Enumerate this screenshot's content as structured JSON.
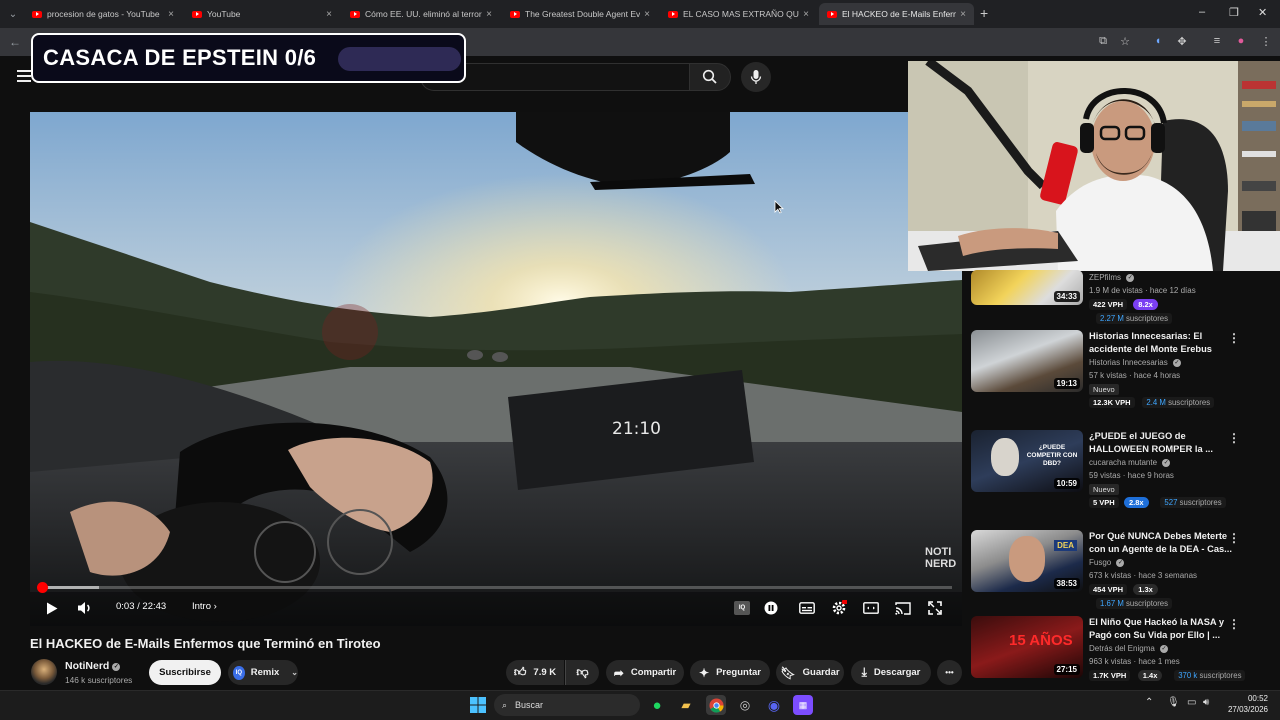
{
  "browser": {
    "tabs": [
      {
        "title": "procesion de gatos - YouTube",
        "active": false
      },
      {
        "title": "YouTube",
        "active": false
      },
      {
        "title": "Cómo EE. UU. eliminó al terrorista",
        "active": false
      },
      {
        "title": "The Greatest Double Agent Ever",
        "active": false
      },
      {
        "title": "EL CASO MAS EXTRAÑO QUE HE",
        "active": false
      },
      {
        "title": "El HACKEO de E-Mails Enfermos",
        "active": true
      }
    ],
    "new_tab_label": "+",
    "close_glyph": "×",
    "window_controls": [
      "–",
      "❐",
      "✕"
    ]
  },
  "stream_overlay": {
    "title": "CASACA DE EPSTEIN 0/6",
    "progress": 0
  },
  "player": {
    "time_current": "0:03",
    "time_total": "22:43",
    "time_separator": "/",
    "chapter": "Intro",
    "chapter_chevron": "›",
    "played_fraction": 0.0022,
    "buffered_fraction": 0.065,
    "scene_clock": "21:10",
    "watermark_line1": "NOTI",
    "watermark_line2": "NERD"
  },
  "video": {
    "title": "El HACKEO de E-Mails Enfermos que Terminó en Tiroteo",
    "channel": "NotiNerd",
    "subscribers": "146 k suscriptores",
    "subscribe_label": "Suscribirse",
    "remix_label": "Remix",
    "remix_badge": "IQ",
    "likes": "7.9 K",
    "share_label": "Compartir",
    "ask_label": "Preguntar",
    "save_label": "Guardar",
    "download_label": "Descargar",
    "more_glyph": "•••"
  },
  "recommendations": [
    {
      "title": "",
      "channel": "ZEPfilms",
      "meta": "1.9 M de vistas · hace 12 días",
      "duration": "34:33",
      "vph": "422 VPH",
      "multiplier": "8.2x",
      "mult_color": "#7b3ff2",
      "subs_num": "2.27 M",
      "subs_label": "suscriptores",
      "is_new": false
    },
    {
      "title": "Historias Innecesarias: El accidente del Monte Erebus",
      "channel": "Historias Innecesarias",
      "meta": "57 k vistas · hace 4 horas",
      "duration": "19:13",
      "vph": "12.3K VPH",
      "multiplier": "",
      "mult_color": "",
      "subs_num": "2.4 M",
      "subs_label": "suscriptores",
      "is_new": true
    },
    {
      "title": "¿PUEDE el JUEGO de HALLOWEEN ROMPER la ...",
      "channel": "cucaracha mutante",
      "meta": "59 vistas · hace 9 horas",
      "duration": "10:59",
      "vph": "5 VPH",
      "multiplier": "2.8x",
      "mult_color": "#1e6fd9",
      "subs_num": "527",
      "subs_label": "suscriptores",
      "is_new": true
    },
    {
      "title": "Por Qué NUNCA Debes Meterte con un Agente de la DEA - Cas...",
      "channel": "Fusgo",
      "meta": "673 k vistas · hace 3 semanas",
      "duration": "38:53",
      "vph": "454 VPH",
      "multiplier": "1.3x",
      "mult_color": "#2a2a2a",
      "subs_num": "1.67 M",
      "subs_label": "suscriptores",
      "is_new": false
    },
    {
      "title": "El Niño Que Hackeó la NASA y Pagó con Su Vida por Ello | ...",
      "channel": "Detrás del Enigma",
      "meta": "963 k vistas · hace 1 mes",
      "duration": "27:15",
      "vph": "1.7K VPH",
      "multiplier": "1.4x",
      "mult_color": "#2a2a2a",
      "subs_num": "370 k",
      "subs_label": "suscriptores",
      "is_new": false
    }
  ],
  "rec_labels": {
    "new_badge": "Nuevo",
    "kebab": "⋮"
  },
  "thumb_text": {
    "halloween": "¿PUEDE COMPETIR CON DBD?",
    "dea": "DEA",
    "nasa_years": "15 AÑOS"
  },
  "taskbar": {
    "search_placeholder": "Buscar",
    "time": "00:52",
    "date": "27/03/2026"
  }
}
